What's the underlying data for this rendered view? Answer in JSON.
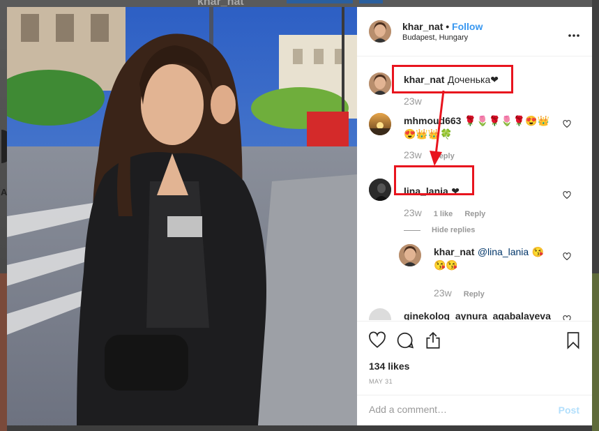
{
  "background": {
    "profile_name": "khar_nat",
    "side_letter": "A"
  },
  "post": {
    "author": "khar_nat",
    "separator": "•",
    "follow_label": "Follow",
    "location": "Budapest, Hungary",
    "more_icon": "more-horizontal-icon"
  },
  "comments": [
    {
      "user": "khar_nat",
      "text": "Доченька❤",
      "time": "23w"
    },
    {
      "user": "mhmoud663",
      "text": "🌹🌷🌹🌷🌹😍👑",
      "text2": "😍👑👑🍀",
      "time": "23w",
      "reply_label": "Reply"
    },
    {
      "user": "lina_lania",
      "text": "❤",
      "time": "23w",
      "likes": "1 like",
      "reply_label": "Reply",
      "hide_replies_label": "Hide replies"
    },
    {
      "user": "khar_nat",
      "mention": "@lina_lania",
      "text": "😘",
      "text2": "😘😘",
      "time": "23w",
      "reply_label": "Reply"
    },
    {
      "user": "ginekolog_aynura_agabalayeva"
    }
  ],
  "actions": {
    "like_icon": "heart-icon",
    "comment_icon": "comment-icon",
    "share_icon": "share-icon",
    "save_icon": "bookmark-icon",
    "likes_count": "134 likes",
    "date": "MAY 31",
    "comment_placeholder": "Add a comment…",
    "post_label": "Post"
  },
  "annotations": {
    "color": "#e8141e"
  },
  "colors": {
    "accent": "#3897f0",
    "post_disabled": "#b2dffc"
  }
}
